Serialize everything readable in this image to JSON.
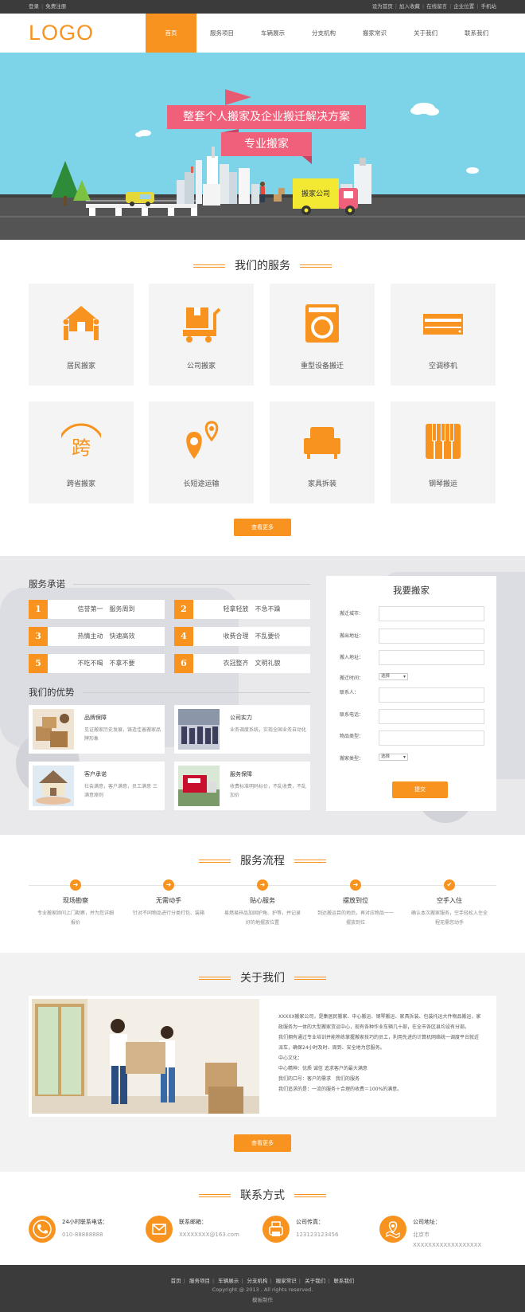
{
  "topbar": {
    "login": "登录",
    "register": "免费注册",
    "right_links": [
      "设为首页",
      "加入收藏",
      "在线留言",
      "企业位置",
      "手机站"
    ]
  },
  "header": {
    "logo": "LOGO",
    "nav": [
      "首页",
      "服务项目",
      "车辆展示",
      "分支机构",
      "搬家常识",
      "关于我们",
      "联系我们"
    ],
    "active_nav": "首页"
  },
  "banner": {
    "headline": "整套个人搬家及企业搬迁解决方案",
    "subline": "专业搬家",
    "truck_label": "搬家公司"
  },
  "services": {
    "title": "我们的服务",
    "items": [
      {
        "label": "居民搬家",
        "icon": "house-movers-icon"
      },
      {
        "label": "公司搬家",
        "icon": "box-cart-icon"
      },
      {
        "label": "重型设备搬迁",
        "icon": "washing-machine-icon"
      },
      {
        "label": "空调移机",
        "icon": "air-conditioner-icon"
      },
      {
        "label": "跨省搬家",
        "icon": "cross-province-icon"
      },
      {
        "label": "长短途运输",
        "icon": "map-pin-icon"
      },
      {
        "label": "家具拆装",
        "icon": "sofa-icon"
      },
      {
        "label": "钢琴搬运",
        "icon": "piano-icon"
      }
    ],
    "more": "查看更多"
  },
  "promise": {
    "title": "服务承诺",
    "items": [
      {
        "num": "1",
        "text": "信誉第一　服务周到"
      },
      {
        "num": "2",
        "text": "轻拿轻放　不急不躁"
      },
      {
        "num": "3",
        "text": "热情主动　快速高效"
      },
      {
        "num": "4",
        "text": "收费合理　不乱要价"
      },
      {
        "num": "5",
        "text": "不吃不喝　不拿不要"
      },
      {
        "num": "6",
        "text": "衣冠整齐　文明礼貌"
      }
    ]
  },
  "advantages": {
    "title": "我们的优势",
    "items": [
      {
        "title": "品牌保障",
        "desc": "见证搬家历史发展，铸造佳善搬家品牌形象"
      },
      {
        "title": "公司实力",
        "desc": "业务调度系统，实现全国业务自动化"
      },
      {
        "title": "客户承诺",
        "desc": "社会满意，客户满意，员工满意 三满意原则"
      },
      {
        "title": "服务保障",
        "desc": "收费标准明码标价，不乱收费，不乱加价"
      }
    ]
  },
  "form": {
    "title": "我要搬家",
    "fields": [
      {
        "label": "搬迁城市："
      },
      {
        "label": "搬出地址："
      },
      {
        "label": "搬入地址："
      },
      {
        "label": "搬迁时间：",
        "select": "选择"
      },
      {
        "label": "联系人："
      },
      {
        "label": "联系电话："
      },
      {
        "label": "物品类型："
      },
      {
        "label": "搬家类型：",
        "select": "选择"
      }
    ],
    "submit": "提交"
  },
  "flow": {
    "title": "服务流程",
    "steps": [
      {
        "title": "现场勘察",
        "desc": "专业搬家顾问上门勘察，并为您详细报价",
        "mark": "➜"
      },
      {
        "title": "无需动手",
        "desc": "针对不同物品进行分类打包、装箱",
        "mark": "➜"
      },
      {
        "title": "贴心服务",
        "desc": "易燃易碎品加固护角、护等，并记录好的地摆放位置",
        "mark": "➜"
      },
      {
        "title": "摆放到位",
        "desc": "到达搬运目的地后，再对应物品一一摆放到位",
        "mark": "➜"
      },
      {
        "title": "空手入住",
        "desc": "确认本次搬家服务，空手轻松入住全程无需您动手",
        "mark": "✔"
      }
    ]
  },
  "about": {
    "title": "关于我们",
    "paragraphs": [
      "XXXXX搬家公司，是集居民搬家、中心搬运、钢琴搬运、家具拆装、包装托运大件物品搬运，家政服务为一体的大型搬家货运中心，现有各种作业车辆几十部，在全市各区县均设有分部。",
      "我们拥有通过专业培训并能熟练掌握搬家技巧的员工，利用先进的计算机网络统一调度平台就近派车，确保24小时及时、周到、安全地为您服务。",
      "中心文化：",
      "中心精神：优质 诚信 追求客户的最大满意",
      "我们的口号：客户的需求　我们的服务",
      "我们追求的是：一流的服务＋合理的收费＝100%的满意。"
    ],
    "more": "查看更多"
  },
  "contact": {
    "title": "联系方式",
    "items": [
      {
        "label": "24小时联系电话：",
        "value": "010-88888888",
        "icon": "phone-icon"
      },
      {
        "label": "联系邮箱：",
        "value": "XXXXXXXX@163.com",
        "icon": "mail-icon"
      },
      {
        "label": "公司传真：",
        "value": "123123123456",
        "icon": "fax-icon"
      },
      {
        "label": "公司地址：",
        "value": "北京市XXXXXXXXXXXXXXXXXX",
        "icon": "location-icon"
      }
    ]
  },
  "footer": {
    "links": [
      "首页",
      "服务项目",
      "车辆展示",
      "分支机构",
      "搬家常识",
      "关于我们",
      "联系我们"
    ],
    "copyright": "Copyright @ 2013 . All rights reserved.",
    "by": "模板制作"
  },
  "colors": {
    "accent": "#f7931e",
    "dark": "#3b3b3b",
    "sky": "#7dd3e8",
    "banner_pink": "#f0607a"
  }
}
